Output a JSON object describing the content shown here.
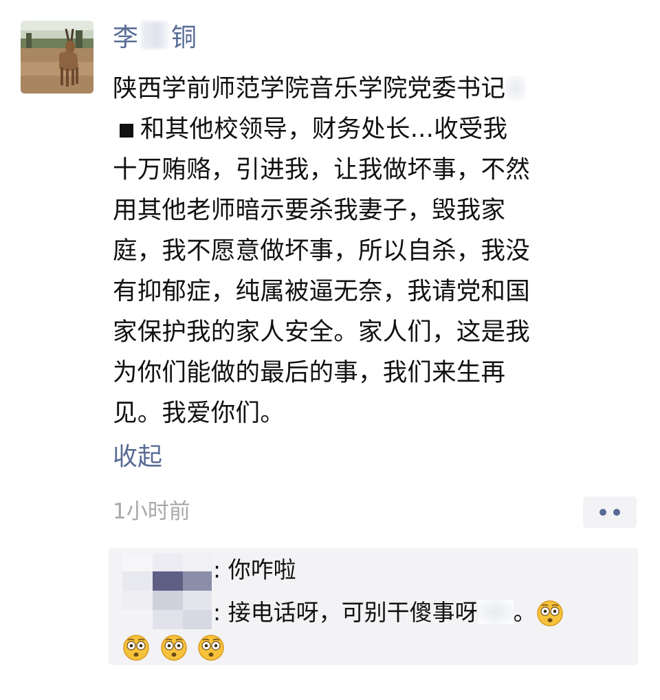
{
  "post": {
    "author_visible": [
      "李",
      "铜"
    ],
    "text_lines": [
      "陕西学前师范学院音乐学院党委书记",
      "和其他校领导，财务处长...收受我",
      "十万贿赂，引进我，让我做坏事，不然",
      "用其他老师暗示要杀我妻子，毁我家",
      "庭，我不愿意做坏事，所以自杀，我没",
      "有抑郁症，纯属被逼无奈，我请党和国",
      "家保护我的家人安全。家人们，这是我",
      "为你们能做的最后的事，我们来生再",
      "见。我爱你们。"
    ],
    "collapse_label": "收起",
    "timestamp": "1小时前"
  },
  "comments": [
    {
      "text": "你咋啦"
    },
    {
      "text": "接电话呀，可别干傻事呀"
    }
  ],
  "emoji": {
    "name": "wide-eyed-face-icon",
    "count_line1": 1,
    "count_line2": 3
  },
  "colors": {
    "link": "#576b95",
    "text": "#111111",
    "timestamp": "#a8a8a8",
    "comment_bg": "#f3f3f5"
  }
}
